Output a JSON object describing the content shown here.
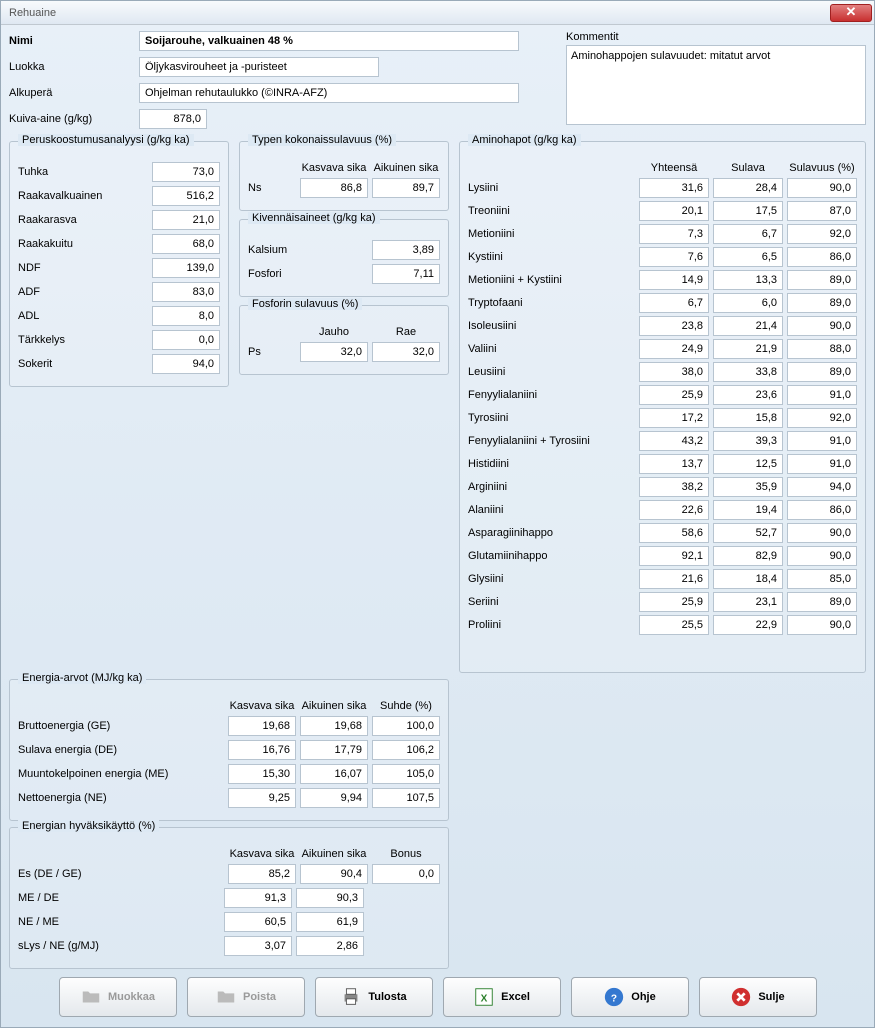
{
  "window": {
    "title": "Rehuaine"
  },
  "labels": {
    "nimi": "Nimi",
    "luokka": "Luokka",
    "alkupera": "Alkuperä",
    "kuiva": "Kuiva-aine (g/kg)",
    "kommentit": "Kommentit"
  },
  "fields": {
    "nimi": "Soijarouhe, valkuainen 48 %",
    "luokka": "Öljykasvirouheet ja -puristeet",
    "alkupera": "Ohjelman rehutaulukko (©INRA-AFZ)",
    "kuiva": "878,0",
    "kommentit": "Aminohappojen sulavuudet: mitatut arvot"
  },
  "perus": {
    "title": "Peruskoostumusanalyysi (g/kg ka)",
    "rows": [
      {
        "l": "Tuhka",
        "v": "73,0"
      },
      {
        "l": "Raakavalkuainen",
        "v": "516,2"
      },
      {
        "l": "Raakarasva",
        "v": "21,0"
      },
      {
        "l": "Raakakuitu",
        "v": "68,0"
      },
      {
        "l": "NDF",
        "v": "139,0"
      },
      {
        "l": "ADF",
        "v": "83,0"
      },
      {
        "l": "ADL",
        "v": "8,0"
      },
      {
        "l": "Tärkkelys",
        "v": "0,0"
      },
      {
        "l": "Sokerit",
        "v": "94,0"
      }
    ]
  },
  "typen": {
    "title": "Typen kokonaissulavuus (%)",
    "h1": "Kasvava sika",
    "h2": "Aikuinen sika",
    "row": {
      "l": "Ns",
      "a": "86,8",
      "b": "89,7"
    }
  },
  "kiven": {
    "title": "Kivennäisaineet (g/kg ka)",
    "rows": [
      {
        "l": "Kalsium",
        "v": "3,89"
      },
      {
        "l": "Fosfori",
        "v": "7,11"
      }
    ]
  },
  "fosfor": {
    "title": "Fosforin sulavuus (%)",
    "h1": "Jauho",
    "h2": "Rae",
    "row": {
      "l": "Ps",
      "a": "32,0",
      "b": "32,0"
    }
  },
  "energia": {
    "title": "Energia-arvot (MJ/kg ka)",
    "h1": "Kasvava sika",
    "h2": "Aikuinen sika",
    "h3": "Suhde (%)",
    "rows": [
      {
        "l": "Bruttoenergia (GE)",
        "a": "19,68",
        "b": "19,68",
        "c": "100,0"
      },
      {
        "l": "Sulava energia (DE)",
        "a": "16,76",
        "b": "17,79",
        "c": "106,2"
      },
      {
        "l": "Muuntokelpoinen energia (ME)",
        "a": "15,30",
        "b": "16,07",
        "c": "105,0"
      },
      {
        "l": "Nettoenergia (NE)",
        "a": "9,25",
        "b": "9,94",
        "c": "107,5"
      }
    ]
  },
  "hyva": {
    "title": "Energian hyväksikäyttö (%)",
    "h1": "Kasvava sika",
    "h2": "Aikuinen sika",
    "h3": "Bonus",
    "rows": [
      {
        "l": "Es (DE / GE)",
        "a": "85,2",
        "b": "90,4",
        "c": "0,0"
      },
      {
        "l": "ME / DE",
        "a": "91,3",
        "b": "90,3",
        "c": ""
      },
      {
        "l": "NE / ME",
        "a": "60,5",
        "b": "61,9",
        "c": ""
      },
      {
        "l": "sLys / NE (g/MJ)",
        "a": "3,07",
        "b": "2,86",
        "c": ""
      }
    ]
  },
  "amino": {
    "title": "Aminohapot (g/kg ka)",
    "h1": "Yhteensä",
    "h2": "Sulava",
    "h3": "Sulavuus (%)",
    "rows": [
      {
        "l": "Lysiini",
        "a": "31,6",
        "b": "28,4",
        "c": "90,0"
      },
      {
        "l": "Treoniini",
        "a": "20,1",
        "b": "17,5",
        "c": "87,0"
      },
      {
        "l": "Metioniini",
        "a": "7,3",
        "b": "6,7",
        "c": "92,0"
      },
      {
        "l": "Kystiini",
        "a": "7,6",
        "b": "6,5",
        "c": "86,0"
      },
      {
        "l": "Metioniini + Kystiini",
        "a": "14,9",
        "b": "13,3",
        "c": "89,0"
      },
      {
        "l": "Tryptofaani",
        "a": "6,7",
        "b": "6,0",
        "c": "89,0"
      },
      {
        "l": "Isoleusiini",
        "a": "23,8",
        "b": "21,4",
        "c": "90,0"
      },
      {
        "l": "Valiini",
        "a": "24,9",
        "b": "21,9",
        "c": "88,0"
      },
      {
        "l": "Leusiini",
        "a": "38,0",
        "b": "33,8",
        "c": "89,0"
      },
      {
        "l": "Fenyylialaniini",
        "a": "25,9",
        "b": "23,6",
        "c": "91,0"
      },
      {
        "l": "Tyrosiini",
        "a": "17,2",
        "b": "15,8",
        "c": "92,0"
      },
      {
        "l": "Fenyylialaniini + Tyrosiini",
        "a": "43,2",
        "b": "39,3",
        "c": "91,0"
      },
      {
        "l": "Histidiini",
        "a": "13,7",
        "b": "12,5",
        "c": "91,0"
      },
      {
        "l": "Arginiini",
        "a": "38,2",
        "b": "35,9",
        "c": "94,0"
      },
      {
        "l": "Alaniini",
        "a": "22,6",
        "b": "19,4",
        "c": "86,0"
      },
      {
        "l": "Asparagiinihappo",
        "a": "58,6",
        "b": "52,7",
        "c": "90,0"
      },
      {
        "l": "Glutamiinihappo",
        "a": "92,1",
        "b": "82,9",
        "c": "90,0"
      },
      {
        "l": "Glysiini",
        "a": "21,6",
        "b": "18,4",
        "c": "85,0"
      },
      {
        "l": "Seriini",
        "a": "25,9",
        "b": "23,1",
        "c": "89,0"
      },
      {
        "l": "Proliini",
        "a": "25,5",
        "b": "22,9",
        "c": "90,0"
      }
    ]
  },
  "buttons": {
    "muokkaa": "Muokkaa",
    "poista": "Poista",
    "tulosta": "Tulosta",
    "excel": "Excel",
    "ohje": "Ohje",
    "sulje": "Sulje"
  }
}
